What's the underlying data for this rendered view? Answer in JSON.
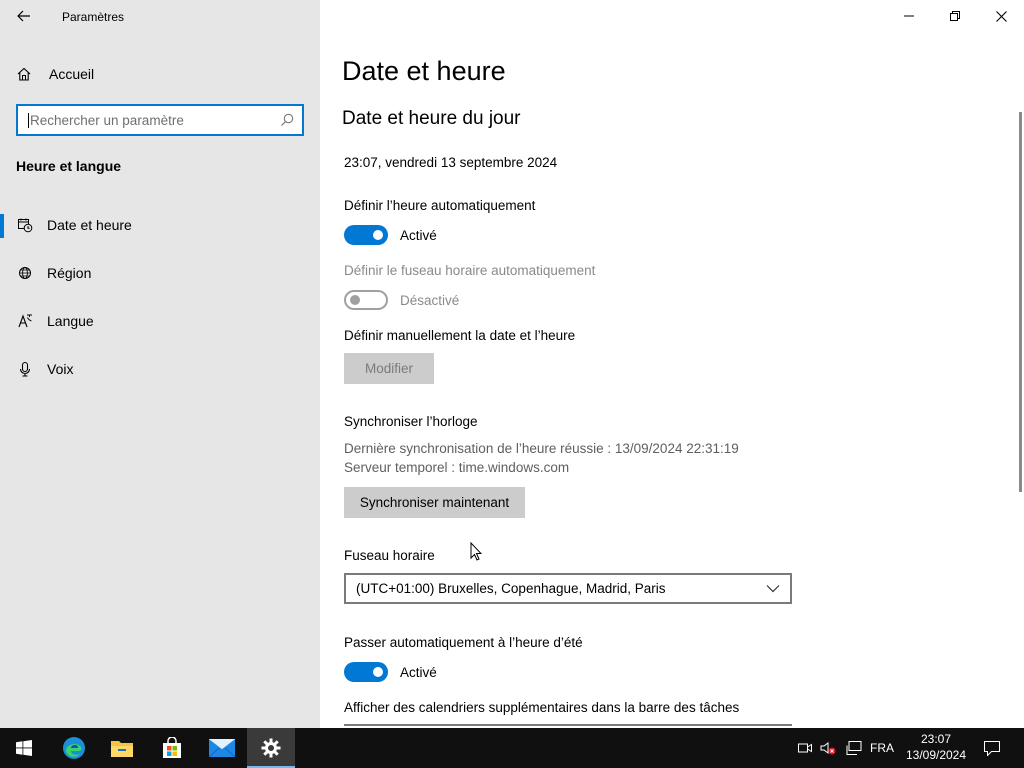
{
  "app": {
    "title": "Paramètres"
  },
  "sidebar": {
    "home_label": "Accueil",
    "search_placeholder": "Rechercher un paramètre",
    "section_heading": "Heure et langue",
    "items": [
      {
        "label": "Date et heure",
        "icon": "clock-calendar-icon",
        "active": true
      },
      {
        "label": "Région",
        "icon": "globe-icon",
        "active": false
      },
      {
        "label": "Langue",
        "icon": "language-icon",
        "active": false
      },
      {
        "label": "Voix",
        "icon": "microphone-icon",
        "active": false
      }
    ]
  },
  "main": {
    "page_title": "Date et heure",
    "section_title": "Date et heure du jour",
    "current_datetime": "23:07, vendredi 13 septembre 2024",
    "auto_time": {
      "label": "Définir l’heure automatiquement",
      "state": "Activé",
      "on": true
    },
    "auto_timezone": {
      "label": "Définir le fuseau horaire automatiquement",
      "state": "Désactivé",
      "on": false,
      "disabled": true
    },
    "manual": {
      "label": "Définir manuellement la date et l’heure",
      "button": "Modifier"
    },
    "sync": {
      "label": "Synchroniser l’horloge",
      "last_sync": "Dernière synchronisation de l’heure réussie : 13/09/2024 22:31:19",
      "server": "Serveur temporel : time.windows.com",
      "button": "Synchroniser maintenant"
    },
    "timezone": {
      "label": "Fuseau horaire",
      "value": "(UTC+01:00) Bruxelles, Copenhague, Madrid, Paris"
    },
    "dst": {
      "label": "Passer automatiquement à l’heure d’été",
      "state": "Activé",
      "on": true
    },
    "extra_calendars": {
      "label": "Afficher des calendriers supplémentaires dans la barre des tâches"
    }
  },
  "taskbar": {
    "apps": [
      "windows-start-icon",
      "edge-icon",
      "file-explorer-icon",
      "store-icon",
      "mail-icon",
      "settings-icon"
    ],
    "language": "FRA",
    "time": "23:07",
    "date": "13/09/2024"
  },
  "colors": {
    "accent": "#0078d4",
    "sidebar_bg": "#e6e6e6",
    "taskbar_bg": "#101010"
  }
}
